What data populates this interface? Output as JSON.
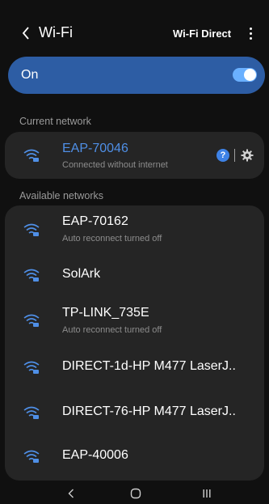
{
  "header": {
    "back_glyph": "<",
    "title": "Wi-Fi",
    "wifi_direct_label": "Wi-Fi Direct",
    "more_icon": "more-vertical-icon"
  },
  "master_toggle": {
    "label": "On",
    "state": "on"
  },
  "current_section": {
    "label": "Current network",
    "network": {
      "name": "EAP-70046",
      "status": "Connected without internet",
      "info_glyph": "?",
      "name_color": "#4f8fe6"
    }
  },
  "available_section": {
    "label": "Available networks",
    "networks": [
      {
        "name": "EAP-70162",
        "subtitle": "Auto reconnect turned off"
      },
      {
        "name": "SolArk",
        "subtitle": ""
      },
      {
        "name": "TP-LINK_735E",
        "subtitle": "Auto reconnect turned off"
      },
      {
        "name": "DIRECT-1d-HP M477 LaserJ..",
        "subtitle": ""
      },
      {
        "name": "DIRECT-76-HP M477 LaserJ..",
        "subtitle": ""
      },
      {
        "name": "EAP-40006",
        "subtitle": ""
      }
    ]
  },
  "navbar": {
    "back_glyph": "<",
    "home_icon": "home-circle-icon",
    "recents_icon": "recents-icon"
  },
  "colors": {
    "background": "#101010",
    "card": "#252525",
    "toggle_card": "#2d5da4",
    "accent": "#3e82e6"
  }
}
